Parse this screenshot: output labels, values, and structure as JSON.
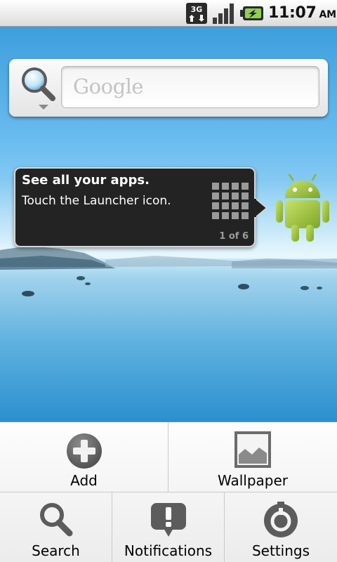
{
  "status_bar": {
    "network_type": "3G",
    "time": "11:07",
    "am_pm": "AM",
    "icons": [
      "3g-data-icon",
      "signal-strength-icon",
      "battery-charging-icon"
    ]
  },
  "search_widget": {
    "placeholder": "Google",
    "icon": "magnifier-icon"
  },
  "launcher_tip": {
    "title": "See all your apps.",
    "body": "Touch the Launcher icon.",
    "page_indicator": "1 of 6",
    "icon": "launcher-grid-icon"
  },
  "mascot": {
    "icon": "android-robot-icon"
  },
  "options_menu": {
    "items": [
      {
        "label": "Add",
        "icon": "add-icon"
      },
      {
        "label": "Wallpaper",
        "icon": "wallpaper-icon"
      },
      {
        "label": "Search",
        "icon": "search-icon"
      },
      {
        "label": "Notifications",
        "icon": "notifications-icon"
      },
      {
        "label": "Settings",
        "icon": "settings-icon"
      }
    ]
  },
  "colors": {
    "accent_green": "#a4c639",
    "tip_background": "#232323",
    "menu_background": "#f4f4f4",
    "sky_blue": "#6cbdf0"
  }
}
